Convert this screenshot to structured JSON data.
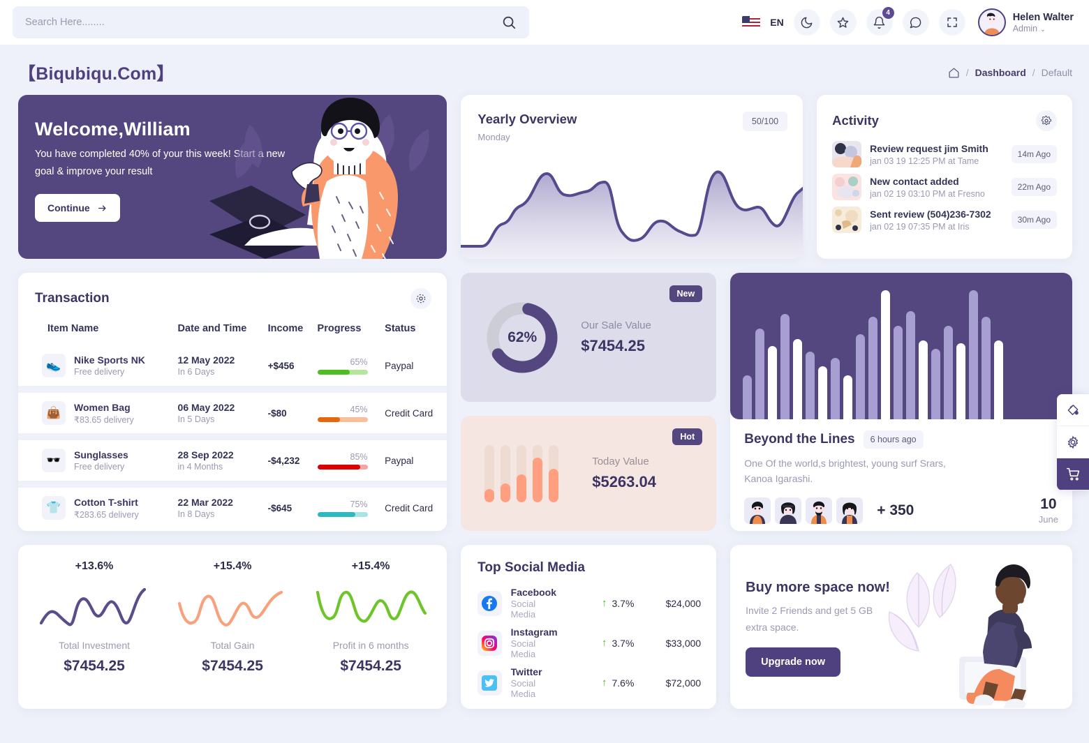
{
  "header": {
    "search": {
      "placeholder": "Search Here........",
      "value": ""
    },
    "language": "EN",
    "icons": [
      "flag-icon",
      "moon-icon",
      "star-icon",
      "bell-icon",
      "chat-icon",
      "fullscreen-icon"
    ],
    "notification_count": "4",
    "user": {
      "name": "Helen Walter",
      "role": "Admin"
    }
  },
  "page": {
    "title": "【Biqubiqu.Com】",
    "breadcrumb": {
      "home": "home-icon",
      "sep": "/",
      "level1": "Dashboard",
      "level2": "Default"
    }
  },
  "welcome": {
    "title": "Welcome,William",
    "text": "You have completed 40% of your this week! Start a new goal & improve your result",
    "button": "Continue"
  },
  "yearly": {
    "title": "Yearly Overview",
    "subtitle": "Monday",
    "pill": "50/100"
  },
  "activity": {
    "title": "Activity",
    "settings_icon": "gear-icon",
    "items": [
      {
        "title": "Review request jim Smith",
        "meta": "jan 03 19 12:25 PM at Tame",
        "time": "14m Ago"
      },
      {
        "title": "New contact added",
        "meta": "jan 02 19 03:10 PM at Fresno",
        "time": "22m Ago"
      },
      {
        "title": "Sent review (504)236-7302",
        "meta": "jan 02 19 07:35 PM at Iris",
        "time": "30m Ago"
      }
    ]
  },
  "transaction": {
    "title": "Transaction",
    "settings_icon": "gear-icon",
    "columns": [
      "Item Name",
      "Date and Time",
      "Income",
      "Progress",
      "Status"
    ],
    "rows": [
      {
        "icon": "👟",
        "name": "Nike Sports NK",
        "sub": "Free delivery",
        "date": "12 May 2022",
        "date_sub": "In 6 Days",
        "income": "+$456",
        "progress": "65%",
        "progress_color": "#51bb25",
        "progress_track": "#b5e69b",
        "status": "Paypal"
      },
      {
        "icon": "👜",
        "name": "Women Bag",
        "sub": "₹83.65 delivery",
        "date": "06 May 2022",
        "date_sub": "In 5 Days",
        "income": "-$80",
        "progress": "45%",
        "progress_color": "#e2680b",
        "progress_track": "#f7c09a",
        "status": "Credit Card"
      },
      {
        "icon": "🕶️",
        "name": "Sunglasses",
        "sub": "Free delivery",
        "date": "28 Sep 2022",
        "date_sub": "in 4 Months",
        "income": "-$4,232",
        "progress": "85%",
        "progress_color": "#dc0000",
        "progress_track": "#f5a3a3",
        "status": "Paypal"
      },
      {
        "icon": "👕",
        "name": "Cotton T-shirt",
        "sub": "₹283.65 delivery",
        "date": "22 Mar 2022",
        "date_sub": "In 8 Days",
        "income": "-$645",
        "progress": "75%",
        "progress_color": "#2fb8c0",
        "progress_track": "#a8e3e6",
        "status": "Credit Card"
      }
    ]
  },
  "sale": {
    "tag": "New",
    "percent": "62%",
    "label": "Our Sale Value",
    "amount": "$7454.25"
  },
  "today": {
    "tag": "Hot",
    "label": "Today Value",
    "amount": "$5263.04"
  },
  "beyond": {
    "title": "Beyond the Lines",
    "tag": "6 hours ago",
    "text": "One Of the world,s brightest, young surf Srars, Kanoa Igarashi.",
    "more": "+ 350",
    "date_day": "10",
    "date_month": "June"
  },
  "stats": [
    {
      "pct": "+13.6%",
      "label": "Total Investment",
      "amount": "$7454.25",
      "color": "#5b4d8a"
    },
    {
      "pct": "+15.4%",
      "label": "Total Gain",
      "amount": "$7454.25",
      "color": "#f9a17c"
    },
    {
      "pct": "+15.4%",
      "label": "Profit in 6 months",
      "amount": "$7454.25",
      "color": "#6ec52a"
    }
  ],
  "social": {
    "title": "Top Social Media",
    "rows": [
      {
        "icon": "facebook-icon",
        "name": "Facebook",
        "sub": "Social Media",
        "pct": "3.7%",
        "value": "$24,000"
      },
      {
        "icon": "instagram-icon",
        "name": "Instagram",
        "sub": "Social Media",
        "pct": "3.7%",
        "value": "$33,000"
      },
      {
        "icon": "twitter-icon",
        "name": "Twitter",
        "sub": "Social Media",
        "pct": "7.6%",
        "value": "$72,000"
      }
    ]
  },
  "upgrade": {
    "title": "Buy more space now!",
    "text": "Invite 2 Friends and get 5 GB extra space.",
    "button": "Upgrade now"
  },
  "dock": {
    "items": [
      "paint-bucket-icon",
      "gear-icon",
      "cart-icon"
    ]
  },
  "chart_data": [
    {
      "type": "area",
      "title": "Yearly Overview",
      "x": [
        0,
        1,
        2,
        3,
        4,
        5,
        6,
        7,
        8,
        9,
        10,
        11,
        12,
        13,
        14,
        15,
        16,
        17,
        18,
        19,
        20,
        21,
        22,
        23
      ],
      "values": [
        12,
        12,
        14,
        35,
        46,
        52,
        78,
        80,
        66,
        62,
        70,
        75,
        46,
        22,
        24,
        38,
        40,
        30,
        28,
        74,
        88,
        62,
        60,
        44,
        80
      ],
      "ylim": [
        0,
        100
      ],
      "grid": false,
      "legend": "none",
      "color": "#544b8e"
    },
    {
      "type": "pie",
      "title": "Our Sale Value",
      "categories": [
        "Completed",
        "Remaining"
      ],
      "values": [
        62,
        38
      ],
      "colors": [
        "#54467e",
        "#cdcdd7"
      ]
    },
    {
      "type": "bar",
      "title": "Today Value",
      "categories": [
        "1",
        "2",
        "3",
        "4",
        "5"
      ],
      "values": [
        22,
        32,
        48,
        78,
        58
      ],
      "ylim": [
        0,
        100
      ],
      "color": "#ff9f7f",
      "track": "#eedbd2"
    },
    {
      "type": "bar",
      "title": "Beyond the Lines activity",
      "categories": [
        "1",
        "2",
        "3",
        "4",
        "5",
        "6",
        "7",
        "8",
        "9",
        "10",
        "11",
        "12",
        "13",
        "14",
        "15",
        "16",
        "17",
        "18",
        "19",
        "20",
        "21",
        "22",
        "23",
        "24",
        "25",
        "26"
      ],
      "values": [
        30,
        62,
        50,
        0,
        72,
        55,
        53,
        0,
        46,
        36,
        42,
        0,
        0,
        58,
        70,
        88,
        0,
        64,
        74,
        54,
        0,
        0,
        48,
        64,
        52,
        0,
        88,
        70,
        54
      ],
      "series": [
        {
          "name": "light",
          "values": [
            30,
            62,
            0,
            72,
            53,
            0,
            46,
            42,
            0,
            58,
            70,
            0,
            64,
            74,
            0,
            48,
            64,
            0,
            88,
            54
          ]
        },
        {
          "name": "white",
          "values": [
            0,
            0,
            50,
            0,
            55,
            0,
            0,
            36,
            0,
            0,
            0,
            88,
            0,
            0,
            54,
            0,
            0,
            52,
            0,
            70
          ]
        }
      ],
      "ylim": [
        0,
        100
      ],
      "colors": [
        "#a79ed1",
        "#ffffff"
      ],
      "background": "#54467e"
    },
    {
      "type": "line",
      "title": "Total Investment",
      "values": [
        20,
        48,
        32,
        16,
        70,
        40,
        72,
        34,
        58,
        24,
        88
      ],
      "color": "#5b4d8a",
      "ylim": [
        0,
        100
      ]
    },
    {
      "type": "line",
      "title": "Total Gain",
      "values": [
        58,
        18,
        62,
        26,
        66,
        20,
        64,
        30,
        48,
        22,
        80
      ],
      "color": "#f9a17c",
      "ylim": [
        0,
        100
      ]
    },
    {
      "type": "line",
      "title": "Profit in 6 months",
      "values": [
        74,
        22,
        70,
        26,
        62,
        24,
        60,
        28,
        74,
        26,
        44
      ],
      "color": "#6ec52a",
      "ylim": [
        0,
        100
      ]
    }
  ]
}
